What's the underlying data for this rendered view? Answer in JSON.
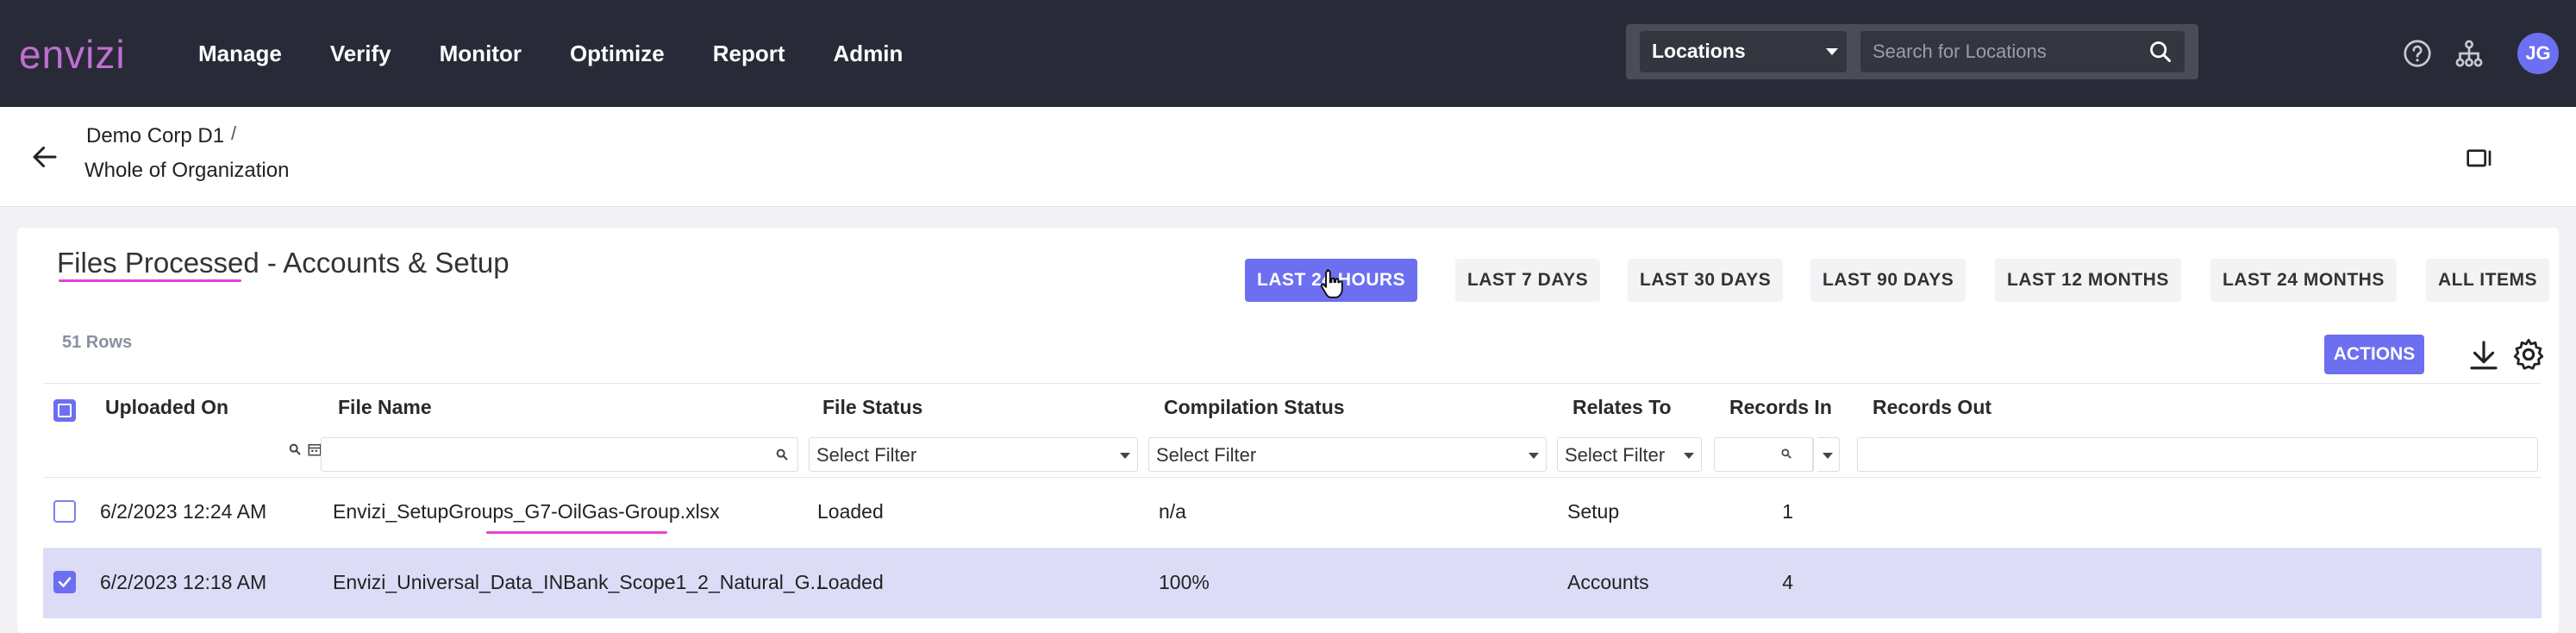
{
  "app": {
    "logo": "envizi"
  },
  "nav": {
    "items": [
      "Manage",
      "Verify",
      "Monitor",
      "Optimize",
      "Report",
      "Admin"
    ]
  },
  "location": {
    "selected": "Locations",
    "search_placeholder": "Search for Locations"
  },
  "user": {
    "initials": "JG"
  },
  "breadcrumb": {
    "org": "Demo Corp D1",
    "separator": "/",
    "scope": "Whole of Organization"
  },
  "page": {
    "title_main": "Files Processed",
    "title_rest": " - Accounts & Setup",
    "row_count": "51 Rows",
    "actions_label": "ACTIONS"
  },
  "ranges": [
    {
      "label": "LAST 24 HOURS",
      "active": true
    },
    {
      "label": "LAST 7 DAYS",
      "active": false
    },
    {
      "label": "LAST 30 DAYS",
      "active": false
    },
    {
      "label": "LAST 90 DAYS",
      "active": false
    },
    {
      "label": "LAST 12 MONTHS",
      "active": false
    },
    {
      "label": "LAST 24 MONTHS",
      "active": false
    },
    {
      "label": "ALL ITEMS",
      "active": false
    }
  ],
  "table": {
    "columns": [
      "Uploaded On",
      "File Name",
      "File Status",
      "Compilation Status",
      "Relates To",
      "Records In",
      "Records Out"
    ],
    "filters": {
      "file_status": "Select Filter",
      "compilation_status": "Select Filter",
      "relates_to": "Select Filter"
    },
    "rows": [
      {
        "checked": false,
        "uploaded_on": "6/2/2023 12:24 AM",
        "file_name": "Envizi_SetupGroups_G7-OilGas-Group.xlsx",
        "file_status": "Loaded",
        "compilation_status": "n/a",
        "relates_to": "Setup",
        "records_in": "1",
        "records_out": ""
      },
      {
        "checked": true,
        "uploaded_on": "6/2/2023 12:18 AM",
        "file_name": "Envizi_Universal_Data_INBank_Scope1_2_Natural_G...",
        "file_status": "Loaded",
        "compilation_status": "100%",
        "relates_to": "Accounts",
        "records_in": "4",
        "records_out": ""
      }
    ]
  },
  "colors": {
    "topbar": "#282a37",
    "accent": "#6b6ff0",
    "logo": "#c06fd1",
    "highlight": "#e541d8",
    "selected_row": "#dcdcf7"
  }
}
